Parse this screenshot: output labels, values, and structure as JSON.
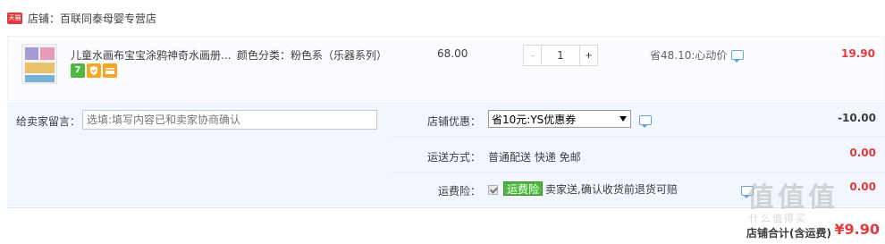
{
  "store": {
    "badge": "天猫",
    "label": "店铺：百联同泰母婴专营店"
  },
  "item": {
    "title": "儿童水画布宝宝涂鸦神奇水画册...",
    "sku_label": "颜色分类：",
    "sku_value": "粉色系（乐器系列）",
    "badges": [
      {
        "icon": "seven-day-return-icon",
        "text": "7"
      },
      {
        "icon": "shield-icon",
        "text": ""
      },
      {
        "icon": "credit-card-icon",
        "text": ""
      }
    ],
    "unit_price": "68.00",
    "quantity": "1",
    "minus": "-",
    "plus": "+",
    "savings": "省48.10:心动价",
    "total": "19.90"
  },
  "memo": {
    "label": "给卖家留言：",
    "placeholder": "选填:填写内容已和卖家协商确认"
  },
  "store_discount": {
    "label": "店铺优惠：",
    "selected": "省10元:YS优惠券",
    "amount": "-10.00"
  },
  "shipping": {
    "label": "运送方式：",
    "value": "普通配送 快递 免邮",
    "amount": "0.00"
  },
  "insurance": {
    "label": "运费险：",
    "tag": "运费险",
    "text": "卖家送,确认收货前退货可赔",
    "amount": "0.00"
  },
  "total": {
    "label": "店铺合计(含运费)",
    "amount": "¥9.90"
  },
  "watermark": {
    "text": "值值值",
    "sub": "什么值得买"
  },
  "colors": {
    "price_red": "#e4393c",
    "option_bg": "#f2f7ff",
    "item_bg": "#fbfcff",
    "tag_green": "#4fb93f",
    "chat_blue": "#5fa3e0"
  }
}
